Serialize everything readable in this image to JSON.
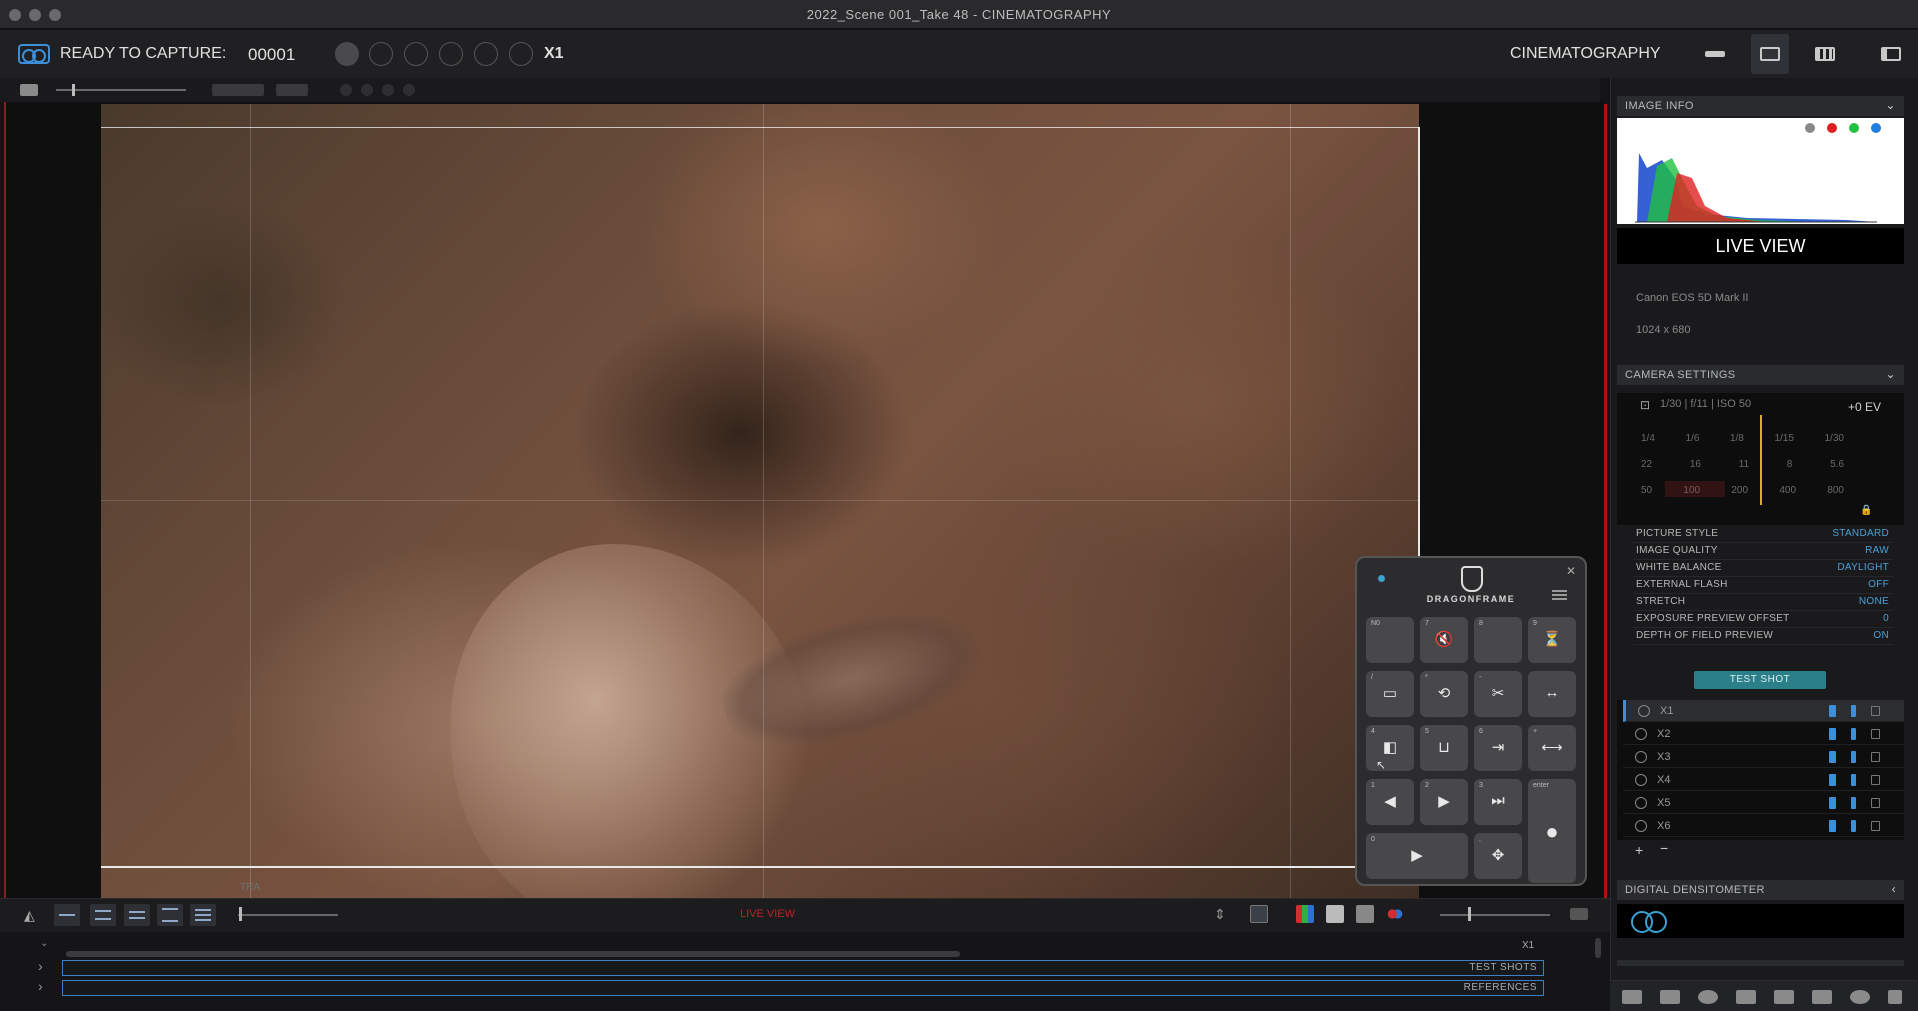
{
  "window": {
    "title": "2022_Scene 001_Take 48 - CINEMATOGRAPHY"
  },
  "capture": {
    "status": "READY TO CAPTURE:",
    "frame": "00001",
    "exposure": "X1"
  },
  "workspace": {
    "label": "CINEMATOGRAPHY"
  },
  "viewer": {
    "status": "LIVE VIEW",
    "bottom_label": "TRA"
  },
  "timeline": {
    "exposure_marker": "X1",
    "tracks": [
      {
        "label": "TEST SHOTS"
      },
      {
        "label": "REFERENCES"
      }
    ]
  },
  "sidebar": {
    "image_info": {
      "title": "IMAGE INFO",
      "view_button": "LIVE VIEW",
      "camera_model": "Canon EOS 5D Mark II",
      "resolution": "1024 x 680"
    },
    "camera_settings": {
      "title": "CAMERA SETTINGS",
      "shutter_aperture": "1/30 | f/11 | ISO 50",
      "exposure_compensation": "+0 EV",
      "dial_shutter": [
        "1/4",
        "1/6",
        "1/8",
        "1/15",
        "1/30"
      ],
      "dial_aperture": [
        "22",
        "16",
        "11",
        "8",
        "5.6"
      ],
      "dial_iso": [
        "50",
        "100",
        "200",
        "400",
        "800"
      ],
      "settings": [
        {
          "name": "PICTURE STYLE",
          "value": "STANDARD"
        },
        {
          "name": "IMAGE QUALITY",
          "value": "RAW"
        },
        {
          "name": "WHITE BALANCE",
          "value": "DAYLIGHT"
        },
        {
          "name": "EXTERNAL FLASH",
          "value": "OFF"
        },
        {
          "name": "STRETCH",
          "value": "NONE"
        },
        {
          "name": "EXPOSURE PREVIEW OFFSET",
          "value": "0"
        },
        {
          "name": "DEPTH OF FIELD PREVIEW",
          "value": "ON"
        }
      ],
      "test_shot_button": "TEST SHOT"
    },
    "exposures": [
      {
        "name": "X1"
      },
      {
        "name": "X2"
      },
      {
        "name": "X3"
      },
      {
        "name": "X4"
      },
      {
        "name": "X5"
      },
      {
        "name": "X6"
      }
    ],
    "densitometer": {
      "title": "DIGITAL DENSITOMETER"
    },
    "histogram_colors": [
      "#888888",
      "#e02020",
      "#20c040",
      "#2080e0"
    ]
  },
  "keypad": {
    "brand": "DRAGONFRAME",
    "keys": [
      {
        "num": "N0",
        "glyph": ""
      },
      {
        "num": "7",
        "glyph": "🔇"
      },
      {
        "num": "8",
        "glyph": ""
      },
      {
        "num": "9",
        "glyph": "⏳"
      },
      {
        "num": "/",
        "glyph": "▭"
      },
      {
        "num": "*",
        "glyph": "⟲"
      },
      {
        "num": "-",
        "glyph": "✂"
      },
      {
        "num": "",
        "glyph": "↔"
      },
      {
        "num": "4",
        "glyph": "◧"
      },
      {
        "num": "5",
        "glyph": "⊔"
      },
      {
        "num": "6",
        "glyph": "⇥"
      },
      {
        "num": "+",
        "glyph": "⟷"
      },
      {
        "num": "1",
        "glyph": "◀"
      },
      {
        "num": "2",
        "glyph": "▶"
      },
      {
        "num": "3",
        "glyph": "⏭"
      },
      {
        "num": "enter",
        "glyph": "●"
      },
      {
        "num": "0",
        "glyph": "▶"
      },
      {
        "num": ".",
        "glyph": "✥"
      }
    ]
  },
  "colors": {
    "accent": "#3c8fd8",
    "live_red": "#b01010",
    "test_shot": "#2a7f88"
  }
}
